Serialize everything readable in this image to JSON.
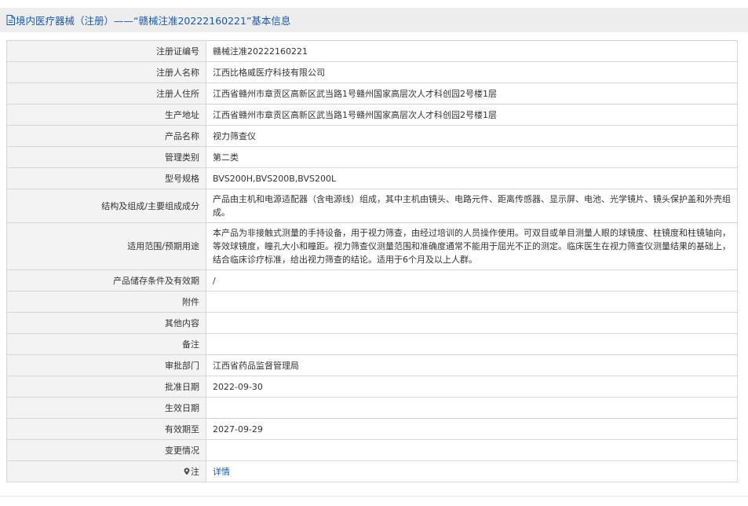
{
  "header": {
    "title": "境内医疗器械（注册）——“赣械注准20222160221”基本信息",
    "icon": "document-icon"
  },
  "rows": [
    {
      "label": "注册证编号",
      "value": "赣械注准20222160221"
    },
    {
      "label": "注册人名称",
      "value": "江西比格威医疗科技有限公司"
    },
    {
      "label": "注册人住所",
      "value": "江西省赣州市章贡区高新区武当路1号赣州国家高层次人才科创园2号楼1层"
    },
    {
      "label": "生产地址",
      "value": "江西省赣州市章贡区高新区武当路1号赣州国家高层次人才科创园2号楼1层"
    },
    {
      "label": "产品名称",
      "value": "视力筛查仪"
    },
    {
      "label": "管理类别",
      "value": "第二类"
    },
    {
      "label": "型号规格",
      "value": "BVS200H,BVS200B,BVS200L"
    },
    {
      "label": "结构及组成/主要组成成分",
      "value": "产品由主机和电源适配器（含电源线）组成，其中主机由镜头、电路元件、距离传感器、显示屏、电池、光学镜片、镜头保护盖和外壳组成。"
    },
    {
      "label": "适用范围/预期用途",
      "value": "本产品为非接触式测量的手持设备，用于视力筛查，由经过培训的人员操作使用。可双目或单目测量人眼的球镜度、柱镜度和柱镜轴向，等效球镜度，瞳孔大小和瞳距。视力筛查仪测量范围和准确度通常不能用于屈光不正的测定。临床医生在视力筛查仪测量结果的基础上，结合临床诊疗标准，给出视力筛查的结论。适用于6个月及以上人群。"
    },
    {
      "label": "产品储存条件及有效期",
      "value": "/"
    },
    {
      "label": "附件",
      "value": ""
    },
    {
      "label": "其他内容",
      "value": ""
    },
    {
      "label": "备注",
      "value": ""
    },
    {
      "label": "审批部门",
      "value": "江西省药品监督管理局"
    },
    {
      "label": "批准日期",
      "value": "2022-09-30"
    },
    {
      "label": "生效日期",
      "value": ""
    },
    {
      "label": "有效期至",
      "value": "2027-09-29"
    },
    {
      "label": "变更情况",
      "value": ""
    }
  ],
  "note_row": {
    "icon": "pin-icon",
    "label": "注",
    "link_text": "详情"
  },
  "colors": {
    "header_bg": "#ededed",
    "header_text": "#1b5aa3",
    "label_bg": "#f3f3f3",
    "border": "#d6d6d6",
    "link": "#1b5aa3"
  }
}
